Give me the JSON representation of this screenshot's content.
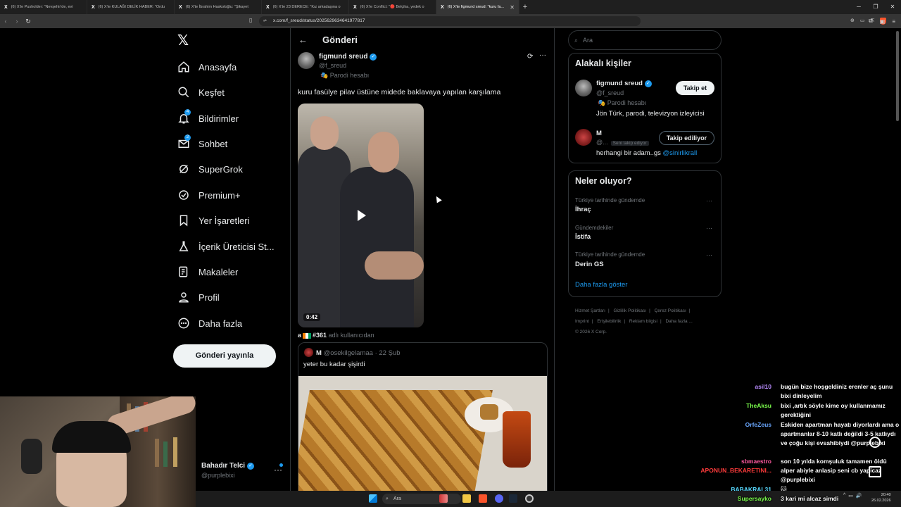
{
  "browser": {
    "tabs": [
      {
        "label": "(6) X'te Pusholder: \"Nevşehir'de, evi"
      },
      {
        "label": "(6) X'te KULAĞI DELİK HABER: \"Ordu"
      },
      {
        "label": "(6) X'te İbrahim Haskoloğlu: \"Şikayet"
      },
      {
        "label": "(6) X'te 23 DERECE: \"Kız arkadaşına o"
      },
      {
        "label": "(6) X'te Conflict: \"🔴 Belçika, yedek o"
      },
      {
        "label": "(6) X'te figmund sreud: \"kuru fa..."
      }
    ],
    "url": "x.com/f_sreud/status/2025629634641977817"
  },
  "sidebar": {
    "items": [
      {
        "label": "Anasayfa",
        "icon": "home-icon"
      },
      {
        "label": "Keşfet",
        "icon": "search-icon"
      },
      {
        "label": "Bildirimler",
        "icon": "bell-icon",
        "badge": "4"
      },
      {
        "label": "Sohbet",
        "icon": "mail-icon",
        "badge": "2"
      },
      {
        "label": "SuperGrok",
        "icon": "grok-icon"
      },
      {
        "label": "Premium+",
        "icon": "verified-icon"
      },
      {
        "label": "Yer İşaretleri",
        "icon": "bookmark-icon"
      },
      {
        "label": "İçerik Üreticisi St...",
        "icon": "flask-icon"
      },
      {
        "label": "Makaleler",
        "icon": "article-icon"
      },
      {
        "label": "Profil",
        "icon": "person-icon"
      },
      {
        "label": "Daha fazla",
        "icon": "more-circle-icon"
      }
    ],
    "post_button": "Gönderi yayınla",
    "profile": {
      "name": "Bahadır Telci",
      "handle": "@purplebixi"
    }
  },
  "main": {
    "title": "Gönderi",
    "tweet": {
      "author_name": "figmund sreud",
      "author_handle": "@f_sreud",
      "author_label": "Parodi hesabı",
      "text": "kuru fasülye pilav üstüne midede baklavaya yapılan karşılama",
      "video_duration": "0:42",
      "from_user_prefix": "a",
      "from_user_name": "#361",
      "from_user_suffix": "adlı kullanıcıdan"
    },
    "quote": {
      "name": "M",
      "handle_date": "@osekilgelamaa · 22 Şub",
      "text": "yeter bu kadar şişirdi"
    }
  },
  "right": {
    "search_placeholder": "Ara",
    "people_title": "Alakalı kişiler",
    "people": [
      {
        "name": "figmund sreud",
        "handle": "@f_sreud",
        "label": "Parodi hesabı",
        "bio": "Jön Türk, parodi, televizyon izleyicisi",
        "button": "Takip et"
      },
      {
        "name": "M",
        "handle": "@...",
        "follows_you": "Seni takip ediyor",
        "bio": "herhangi bir adam..gs",
        "bio_link": "@sinirlikrall",
        "button": "Takip ediliyor"
      }
    ],
    "trends_title": "Neler oluyor?",
    "trends": [
      {
        "context": "Türkiye tarihinde gündemde",
        "name": "İhraç"
      },
      {
        "context": "Gündemdekiler",
        "name": "İstifa"
      },
      {
        "context": "Türkiye tarihinde gündemde",
        "name": "Derin GS"
      }
    ],
    "show_more": "Daha fazla göster",
    "footer": [
      "Hizmet Şartları",
      "|",
      "Gizlilik Politikası",
      "|",
      "Çerez Politikası",
      "|",
      "Imprint",
      "|",
      "Erişilebilirlik",
      "|",
      "Reklam bilgisi",
      "|",
      "Daha fazla ...",
      "© 2026 X Corp."
    ]
  },
  "chat": [
    {
      "user": "asil10",
      "color": "#b98cff",
      "text": "bugün bize hoşgeldiniz erenler aç şunu bixi dinleyelim"
    },
    {
      "user": "TheAksu",
      "color": "#7cff4d",
      "text": "bixi ,artık söyle kime oy kullanmamız gerektiğini"
    },
    {
      "user": "OrfeZeus",
      "color": "#6aa7ff",
      "text": "Eskiden apartman hayatı diyorlardı ama o apartmanlar 8-10 katlı değildi 3-5 katlıydı ve çoğu kişi evsahibiydi @purplebixi"
    },
    {
      "user": "sbmaestro",
      "color": "#ff5aa0",
      "text": "son 10 yılda komşuluk tamamen öldü"
    },
    {
      "user": "APONUN_BEKARETINI...",
      "color": "#ff3b3b",
      "text": "alper abiyle anlasip seni cb yapicaz @purplebixi"
    },
    {
      "user": "BABAKRAL31",
      "color": "#57d9ff",
      "text": "🐱"
    },
    {
      "user": "Supersayko",
      "color": "#7cff4d",
      "text": "3 kari mi alcaz simdi"
    }
  ],
  "taskbar": {
    "search": "Ara",
    "time": "20:40",
    "date": "26.02.2026"
  }
}
